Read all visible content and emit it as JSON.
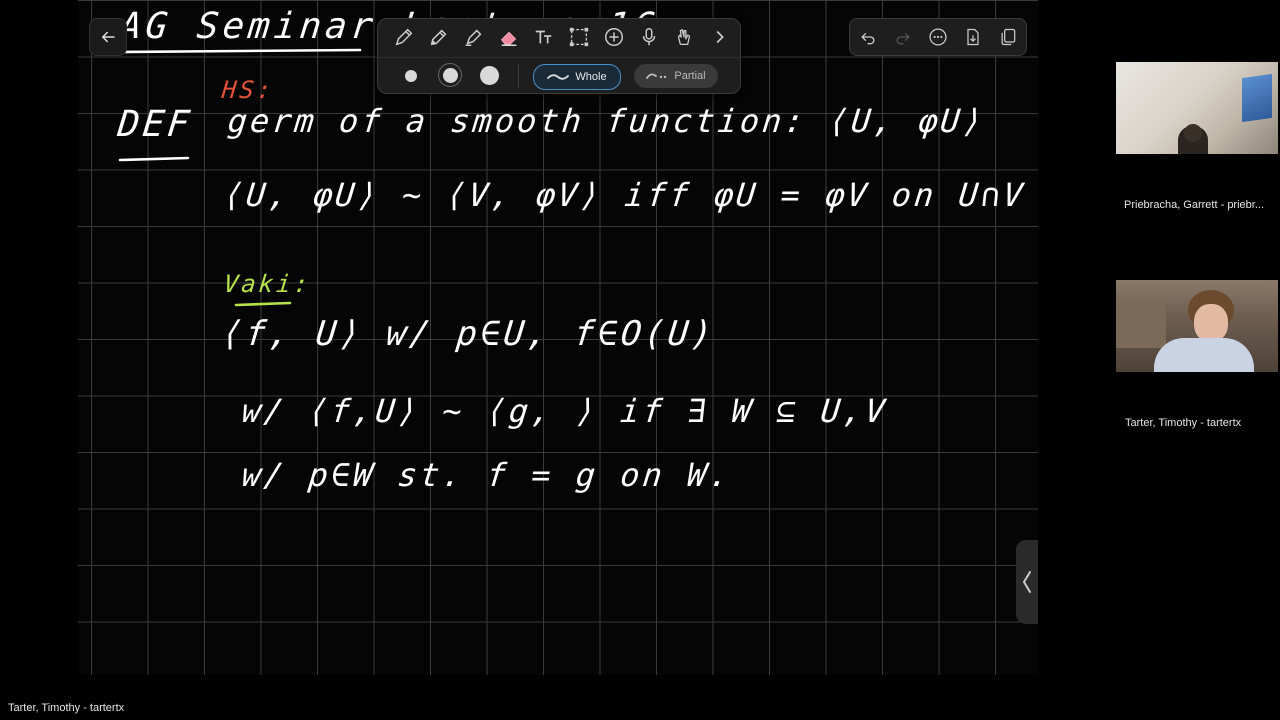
{
  "notes": {
    "title": "AG Seminar Lecture 16",
    "annotation_red": "HS:",
    "def_label": "DEF",
    "line1": "germ of a smooth function: ⟨U, φU⟩",
    "line2": "⟨U, φU⟩ ~ ⟨V, φV⟩  iff  φU = φV on U∩V",
    "annotation_green": "Vaki:",
    "line3": "⟨f, U⟩  w/ p∈U,  f∈O(U)",
    "line4": "w/ ⟨f,U⟩ ~ ⟨g,  ⟩ if ∃ W ⊆ U,V",
    "line5": "w/ p∈W  st.  f = g  on W."
  },
  "toolbar": {
    "tools": [
      "pen-icon",
      "pencil-icon",
      "highlighter-icon",
      "eraser-icon",
      "text-icon",
      "lasso-icon",
      "add-icon",
      "microphone-icon",
      "gesture-icon",
      "chevron-right-icon"
    ],
    "sizes": [
      "small",
      "medium",
      "large"
    ],
    "selected_size": "medium",
    "eraser_modes": [
      "Whole",
      "Partial"
    ],
    "selected_mode": "Whole",
    "accent": "#4a90c8"
  },
  "right_tools": [
    "undo-icon",
    "redo-icon",
    "more-icon",
    "export-icon",
    "pages-icon"
  ],
  "participants": [
    {
      "name": "Priebracha, Garrett - priebr..."
    },
    {
      "name": "Tarter, Timothy - tartertx"
    }
  ],
  "active_speaker": "Tarter, Timothy - tartertx"
}
